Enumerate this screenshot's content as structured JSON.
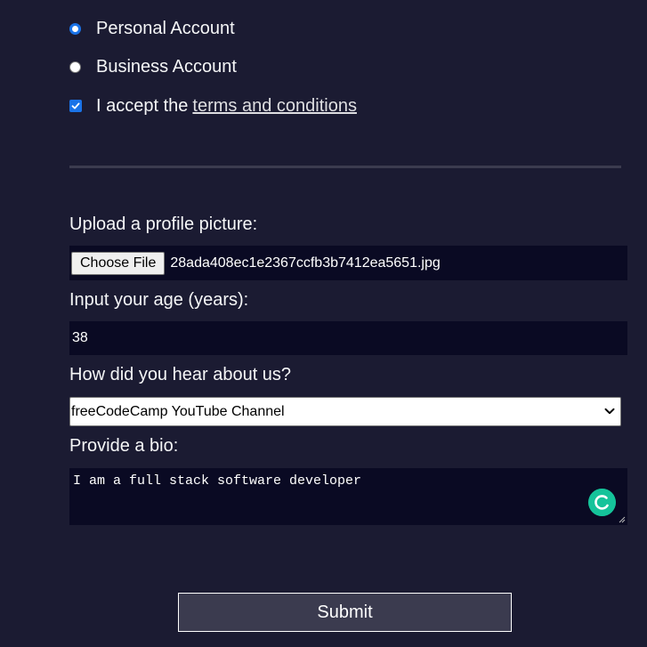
{
  "account_type": {
    "personal_label": "Personal Account",
    "business_label": "Business Account",
    "selected": "personal"
  },
  "terms": {
    "prefix": "I accept the",
    "link_text": "terms and conditions",
    "checked": true
  },
  "profile_picture": {
    "label": "Upload a profile picture:",
    "button_label": "Choose File",
    "file_name": "28ada408ec1e2367ccfb3b7412ea5651.jpg"
  },
  "age": {
    "label": "Input your age (years):",
    "value": "38"
  },
  "referrer": {
    "label": "How did you hear about us?",
    "selected_option": "freeCodeCamp YouTube Channel"
  },
  "bio": {
    "label": "Provide a bio:",
    "value": "I am a full stack software developer"
  },
  "submit_label": "Submit",
  "colors": {
    "background": "#1b1b32",
    "field_background": "#0a0a23",
    "divider": "#3b3b4f",
    "accent": "#1a73e8",
    "grammarly": "#15c39a"
  },
  "icons": [
    "chevron-down-icon",
    "grammarly-icon",
    "resize-handle-icon",
    "checkmark-icon"
  ]
}
